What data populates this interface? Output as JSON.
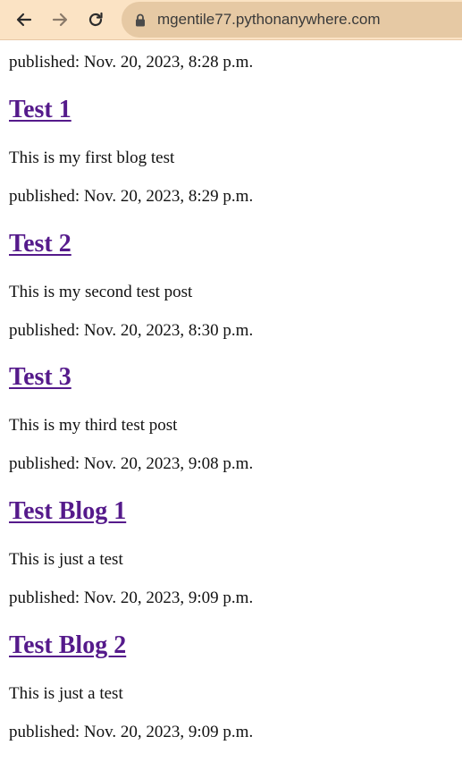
{
  "browser": {
    "url": "mgentile77.pythonanywhere.com",
    "back_icon": "arrow-left-icon",
    "forward_icon": "arrow-right-icon",
    "reload_icon": "reload-icon",
    "lock_icon": "lock-icon",
    "toolbar_color": "#fbe3c4",
    "omnibox_color": "#e6c9a4"
  },
  "page": {
    "link_color": "#551a8b",
    "first_published": "published: Nov. 20, 2023, 8:28 p.m.",
    "posts": [
      {
        "title": "Test 1",
        "body": "This is my first blog test",
        "published": "published: Nov. 20, 2023, 8:29 p.m."
      },
      {
        "title": "Test 2",
        "body": "This is my second test post",
        "published": "published: Nov. 20, 2023, 8:30 p.m."
      },
      {
        "title": "Test 3",
        "body": "This is my third test post",
        "published": "published: Nov. 20, 2023, 9:08 p.m."
      },
      {
        "title": "Test Blog 1",
        "body": "This is just a test",
        "published": "published: Nov. 20, 2023, 9:09 p.m."
      },
      {
        "title": "Test Blog 2",
        "body": "This is just a test",
        "published": "published: Nov. 20, 2023, 9:09 p.m."
      }
    ]
  }
}
